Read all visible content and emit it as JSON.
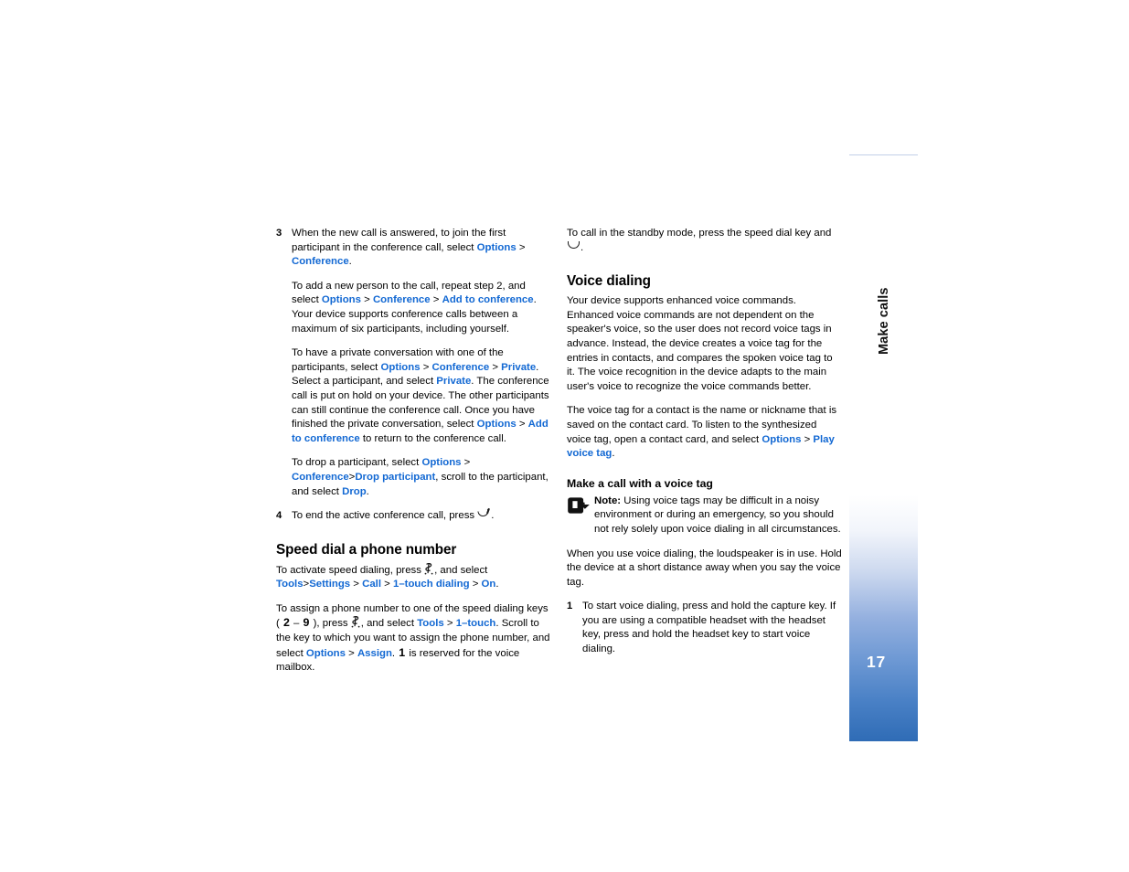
{
  "document": {
    "sidebar": {
      "chapter_title": "Make calls",
      "page_number": "17",
      "gradient_from": "#ffffff",
      "gradient_to": "#2f6cb6"
    },
    "link_color": "#1268d3"
  },
  "left_column": {
    "step3": {
      "number": "3",
      "text_a": "When the new call is answered, to join the first participant in the conference call, select ",
      "link_options_1": "Options",
      "sep_1": " > ",
      "link_conference_1": "Conference",
      "text_b": "."
    },
    "para_add_person": {
      "text_a": "To add a new person to the call, repeat step 2, and select ",
      "link_options": "Options",
      "sep_1": " > ",
      "link_conference": "Conference",
      "sep_2": " > ",
      "link_add_to_conference": "Add to conference",
      "text_b": ". Your device supports conference calls between a maximum of six participants, including yourself."
    },
    "para_private": {
      "text_a": "To have a private conversation with one of the participants, select ",
      "link_options": "Options",
      "sep_1": " > ",
      "link_conference": "Conference",
      "sep_2": " > ",
      "link_private_1": "Private",
      "text_b": ". Select a participant, and select ",
      "link_private_2": "Private",
      "text_c": ". The conference call is put on hold on your device. The other participants can still continue the conference call. Once you have finished the private conversation, select ",
      "link_options_2": "Options",
      "sep_3": " > ",
      "link_add_to_conference": "Add to conference",
      "text_d": " to return to the conference call."
    },
    "para_drop": {
      "text_a": "To drop a participant, select ",
      "link_options": "Options",
      "sep_1": " > ",
      "link_conference": "Conference",
      "sep_2": ">",
      "link_drop_participant": "Drop participant",
      "text_b": ", scroll to the participant, and select ",
      "link_drop": "Drop",
      "text_c": "."
    },
    "step4": {
      "number": "4",
      "text_a": "To end the active conference call, press ",
      "icon_end_key": "end-call-key-icon",
      "text_b": "."
    },
    "heading_speed_dial": "Speed dial a phone number",
    "para_activate": {
      "text_a": "To activate speed dialing, press ",
      "icon_menu_key": "menu-key-icon",
      "text_b": ", and select ",
      "link_tools": "Tools",
      "sep_1": ">",
      "link_settings": "Settings",
      "sep_2": " > ",
      "link_call": "Call",
      "sep_3": " > ",
      "link_one_touch_dialing": "1–touch dialing",
      "sep_4": " > ",
      "link_on": "On",
      "text_c": "."
    },
    "para_assign": {
      "text_a": "To assign a phone number to one of the speed dialing keys ( ",
      "key_2": "2",
      "dash": " – ",
      "key_9": "9",
      "text_b": " ), press ",
      "icon_menu_key": "menu-key-icon",
      "text_c": ", and select ",
      "link_tools": "Tools",
      "sep_1": " > ",
      "link_one_touch": "1–touch",
      "text_d": ". Scroll to the key to which you want to assign the phone number, and select ",
      "link_options": "Options",
      "sep_2": " > ",
      "link_assign": "Assign",
      "text_e": ". ",
      "key_1": "1",
      "text_f": " is reserved for the voice mailbox."
    }
  },
  "right_column": {
    "para_standby": {
      "text_a": "To call in the standby mode, press the speed dial key and ",
      "icon_call_key": "call-key-icon",
      "text_b": "."
    },
    "heading_voice_dialing": "Voice dialing",
    "para_enhanced": "Your device supports enhanced voice commands. Enhanced voice commands are not dependent on the speaker's voice, so the user does not record voice tags in advance. Instead, the device creates a voice tag for the entries in contacts, and compares the spoken voice tag to it. The voice recognition in the device adapts to the main user's voice to recognize the voice commands better.",
    "para_voice_tag": {
      "text_a": "The voice tag for a contact is the name or nickname that is saved on the contact card. To listen to the synthesized voice tag, open a contact card, and select ",
      "link_options": "Options",
      "sep_1": " > ",
      "link_play_voice_tag": "Play voice tag",
      "text_b": "."
    },
    "subheading_make_call": "Make a call with a voice tag",
    "note": {
      "icon": "note-arrow-icon",
      "label": "Note:",
      "text": " Using voice tags may be difficult in a noisy environment or during an emergency, so you should not rely solely upon voice dialing in all circumstances."
    },
    "para_loudspeaker": "When you use voice dialing, the loudspeaker is in use. Hold the device at a short distance away when you say the voice tag.",
    "step1": {
      "number": "1",
      "text": "To start voice dialing, press and hold the capture key. If you are using a compatible headset with the headset key, press and hold the headset key to start voice dialing."
    }
  }
}
